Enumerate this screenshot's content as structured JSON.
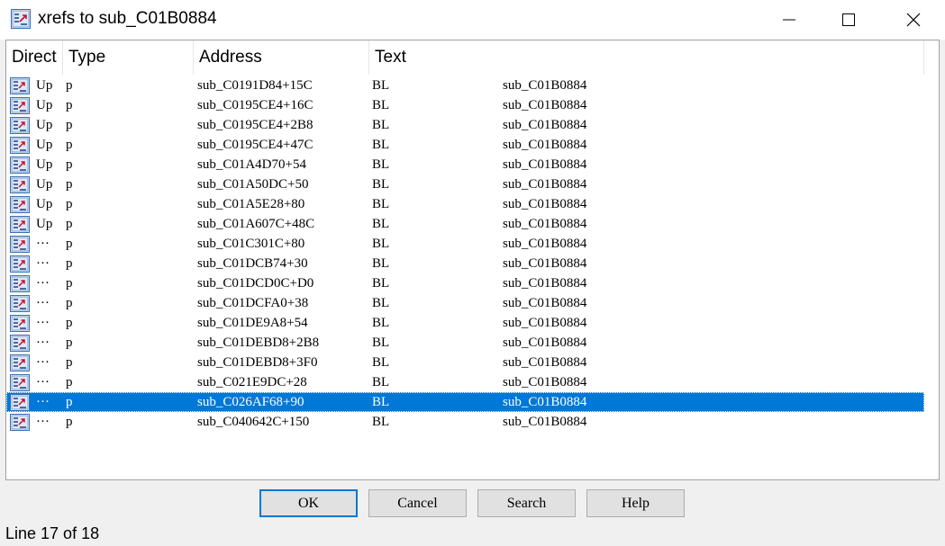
{
  "window": {
    "title": "xrefs to sub_C01B0884",
    "icon": "xref-list-icon",
    "controls": [
      "minimize-icon",
      "maximize-icon",
      "close-icon"
    ]
  },
  "columns": {
    "direction": "Direct",
    "type": "Type",
    "address": "Address",
    "text": "Text"
  },
  "rows": [
    {
      "direction": "Up",
      "type": "p",
      "address": "sub_C0191D84+15C",
      "instruction": "BL",
      "target": "sub_C01B0884",
      "selected": false
    },
    {
      "direction": "Up",
      "type": "p",
      "address": "sub_C0195CE4+16C",
      "instruction": "BL",
      "target": "sub_C01B0884",
      "selected": false
    },
    {
      "direction": "Up",
      "type": "p",
      "address": "sub_C0195CE4+2B8",
      "instruction": "BL",
      "target": "sub_C01B0884",
      "selected": false
    },
    {
      "direction": "Up",
      "type": "p",
      "address": "sub_C0195CE4+47C",
      "instruction": "BL",
      "target": "sub_C01B0884",
      "selected": false
    },
    {
      "direction": "Up",
      "type": "p",
      "address": "sub_C01A4D70+54",
      "instruction": "BL",
      "target": "sub_C01B0884",
      "selected": false
    },
    {
      "direction": "Up",
      "type": "p",
      "address": "sub_C01A50DC+50",
      "instruction": "BL",
      "target": "sub_C01B0884",
      "selected": false
    },
    {
      "direction": "Up",
      "type": "p",
      "address": "sub_C01A5E28+80",
      "instruction": "BL",
      "target": "sub_C01B0884",
      "selected": false
    },
    {
      "direction": "Up",
      "type": "p",
      "address": "sub_C01A607C+48C",
      "instruction": "BL",
      "target": "sub_C01B0884",
      "selected": false
    },
    {
      "direction": "···",
      "type": "p",
      "address": "sub_C01C301C+80",
      "instruction": "BL",
      "target": "sub_C01B0884",
      "selected": false
    },
    {
      "direction": "···",
      "type": "p",
      "address": "sub_C01DCB74+30",
      "instruction": "BL",
      "target": "sub_C01B0884",
      "selected": false
    },
    {
      "direction": "···",
      "type": "p",
      "address": "sub_C01DCD0C+D0",
      "instruction": "BL",
      "target": "sub_C01B0884",
      "selected": false
    },
    {
      "direction": "···",
      "type": "p",
      "address": "sub_C01DCFA0+38",
      "instruction": "BL",
      "target": "sub_C01B0884",
      "selected": false
    },
    {
      "direction": "···",
      "type": "p",
      "address": "sub_C01DE9A8+54",
      "instruction": "BL",
      "target": "sub_C01B0884",
      "selected": false
    },
    {
      "direction": "···",
      "type": "p",
      "address": "sub_C01DEBD8+2B8",
      "instruction": "BL",
      "target": "sub_C01B0884",
      "selected": false
    },
    {
      "direction": "···",
      "type": "p",
      "address": "sub_C01DEBD8+3F0",
      "instruction": "BL",
      "target": "sub_C01B0884",
      "selected": false
    },
    {
      "direction": "···",
      "type": "p",
      "address": "sub_C021E9DC+28",
      "instruction": "BL",
      "target": "sub_C01B0884",
      "selected": false
    },
    {
      "direction": "···",
      "type": "p",
      "address": "sub_C026AF68+90",
      "instruction": "BL",
      "target": "sub_C01B0884",
      "selected": true
    },
    {
      "direction": "···",
      "type": "p",
      "address": "sub_C040642C+150",
      "instruction": "BL",
      "target": "sub_C01B0884",
      "selected": false
    }
  ],
  "row_icon": "xref-item-icon",
  "buttons": {
    "ok": "OK",
    "cancel": "Cancel",
    "search": "Search",
    "help": "Help"
  },
  "status": {
    "text": "Line 17 of 18"
  },
  "colors": {
    "selection": "#0078d7",
    "default_button_border": "#0078d7",
    "button_face": "#e1e1e1"
  }
}
